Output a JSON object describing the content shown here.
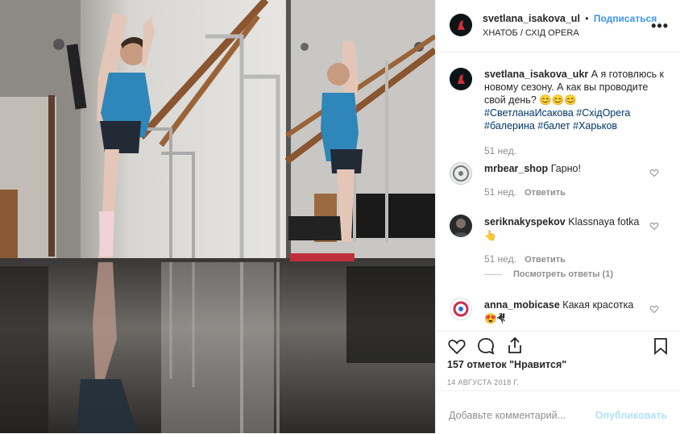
{
  "header": {
    "username": "svetlana_isakova_ul",
    "separator": "•",
    "follow": "Подписаться",
    "location": "ХНАТОБ / СХІД OPERA",
    "more": "•••"
  },
  "caption": {
    "username": "svetlana_isakova_ukr",
    "text": "А я готовлюсь к новому сезону. А как вы проводите свой день? 😊😊😊",
    "tags": [
      "#СветланаИсакова",
      "#СхідOpera",
      "#балерина",
      "#балет",
      "#Харьков"
    ],
    "time": "51 нед."
  },
  "comments": [
    {
      "username": "mrbear_shop",
      "text": "Гарно!",
      "time": "51 нед.",
      "reply": "Ответить"
    },
    {
      "username": "seriknakyspekov",
      "text": "Klassnaya fotka 👆",
      "time": "51 нед.",
      "reply": "Ответить",
      "view_replies": "Посмотреть ответы (1)"
    },
    {
      "username": "anna_mobicase",
      "text": "Какая красотка 😍🤻"
    }
  ],
  "likes": "157 отметок \"Нравится\"",
  "date": "14 АВГУСТА 2018 Г.",
  "add_comment": {
    "placeholder": "Добавьте комментарий...",
    "publish": "Опубликовать"
  },
  "icons": {
    "like": "heart-icon",
    "comment": "comment-icon",
    "share": "share-icon",
    "save": "bookmark-icon"
  },
  "colors": {
    "link": "#3897f0",
    "hashtag": "#003569",
    "muted": "#8e8e8e",
    "publish_disabled": "#b2dffc"
  }
}
